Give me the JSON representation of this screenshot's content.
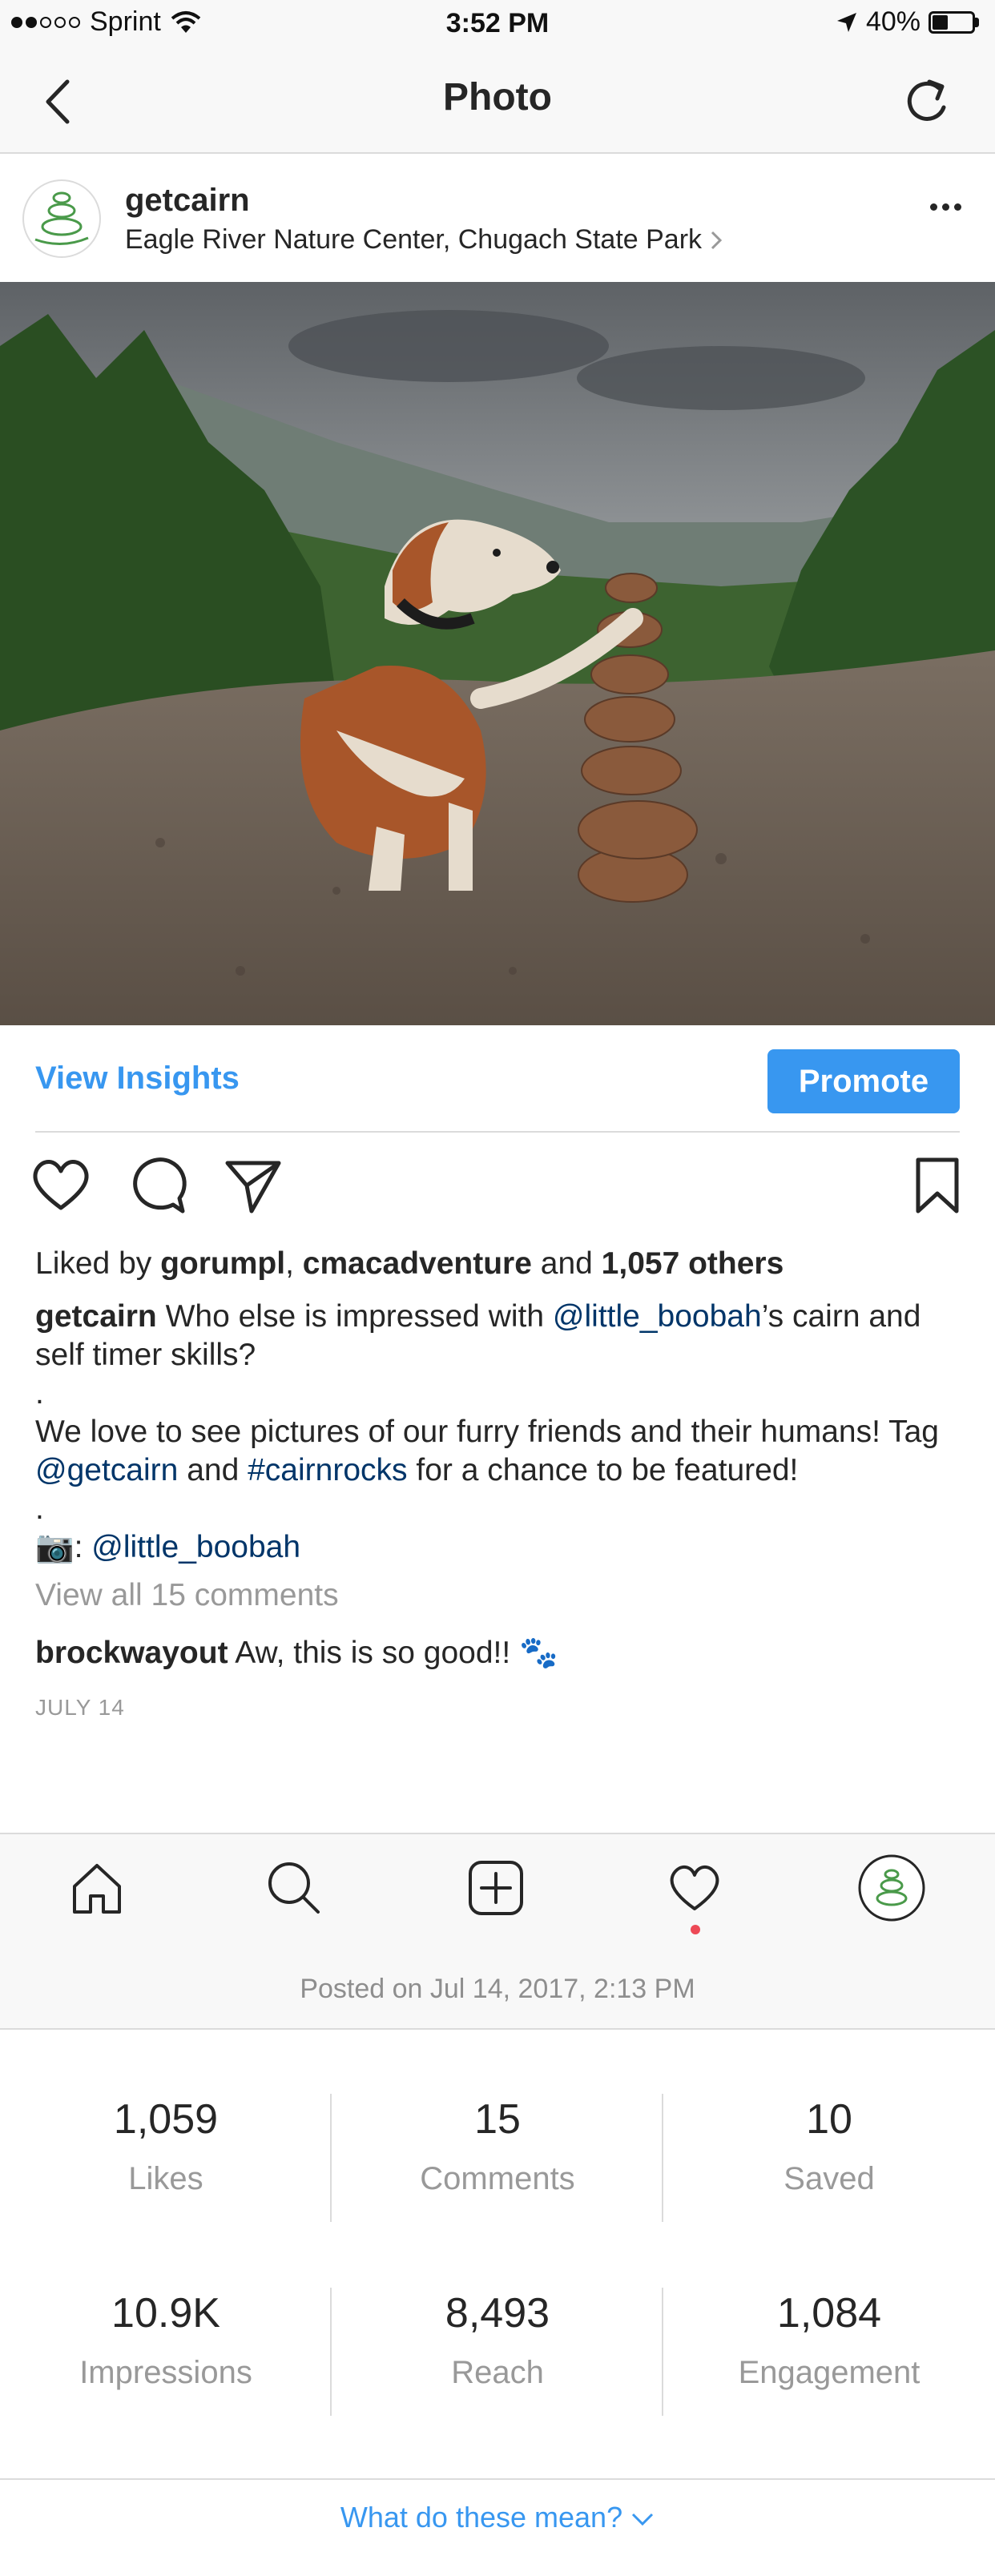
{
  "status_bar": {
    "carrier": "Sprint",
    "time": "3:52 PM",
    "battery": "40%",
    "battery_level": 0.4,
    "signal_bars_filled": 2,
    "signal_bars_total": 5
  },
  "nav": {
    "title": "Photo",
    "back_icon": "chevron-left-icon",
    "refresh_icon": "refresh-icon"
  },
  "post": {
    "username": "getcairn",
    "location": "Eagle River Nature Center, Chugach State Park",
    "more_icon": "more-dots-icon"
  },
  "insights_bar": {
    "view_insights": "View Insights",
    "promote": "Promote",
    "accent_color": "#3897f0"
  },
  "likes": {
    "prefix": "Liked by",
    "user1": "gorumpl",
    "user2": "cmacadventure",
    "connector": "and",
    "others": "1,057 others"
  },
  "caption": {
    "author": "getcairn",
    "text1": "Who else is impressed with",
    "mention1": "@little_boobah",
    "text2": "’s cairn and self timer skills?",
    "dot1": ".",
    "text3": "We love to see pictures of our furry friends and their humans! Tag",
    "mention2": "@getcairn",
    "and": "and",
    "hashtag": "#cairnrocks",
    "text4": "for a chance to be featured!",
    "dot2": ".",
    "camera_emoji": "📷",
    "colon": ":",
    "mention3": "@little_boobah"
  },
  "comments": {
    "view_all": "View all 15 comments",
    "comment_user": "brockwayout",
    "comment_text": "Aw, this is so good!!",
    "comment_emoji": "🐾",
    "date": "JULY 14"
  },
  "tab_bar": {
    "items": [
      "home-icon",
      "search-icon",
      "add-post-icon",
      "activity-heart-icon",
      "profile-avatar"
    ]
  },
  "posted_on": "Posted on Jul 14, 2017, 2:13 PM",
  "stats": [
    {
      "value": "1,059",
      "label": "Likes"
    },
    {
      "value": "15",
      "label": "Comments"
    },
    {
      "value": "10",
      "label": "Saved"
    },
    {
      "value": "10.9K",
      "label": "Impressions"
    },
    {
      "value": "8,493",
      "label": "Reach"
    },
    {
      "value": "1,084",
      "label": "Engagement"
    }
  ],
  "what_mean": "What do these mean?"
}
